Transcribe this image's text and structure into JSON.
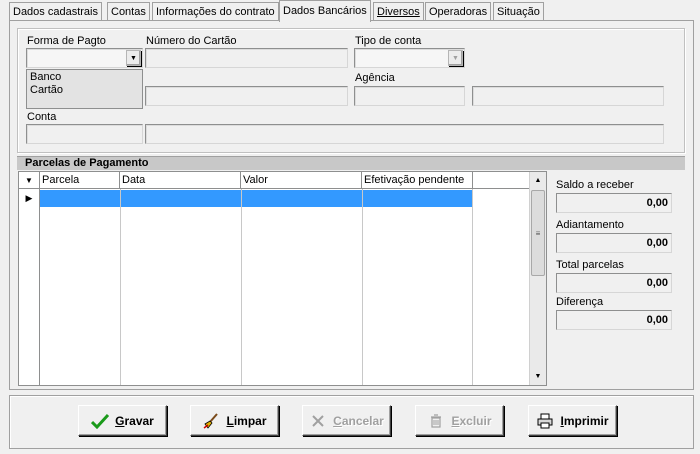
{
  "tabs": [
    {
      "label": "Dados cadastrais"
    },
    {
      "label": "Contas"
    },
    {
      "label": "Informações do contrato"
    },
    {
      "label": "Dados Bancários"
    },
    {
      "label": "Diversos"
    },
    {
      "label": "Operadoras"
    },
    {
      "label": "Situação"
    }
  ],
  "active_tab": "Dados Bancários",
  "form": {
    "forma_pagto_label": "Forma de Pagto",
    "forma_pagto_value": "",
    "forma_pagto_options": [
      "Banco",
      "Cartão"
    ],
    "numero_cartao_label": "Número do Cartão",
    "tipo_conta_label": "Tipo de conta",
    "agencia_label": "Agência",
    "conta_label": "Conta"
  },
  "parcelas": {
    "title": "Parcelas de Pagamento",
    "columns": [
      "Parcela",
      "Data",
      "Valor",
      "Efetivação pendente"
    ],
    "rows": []
  },
  "summary": {
    "saldo_label": "Saldo a receber",
    "saldo_value": "0,00",
    "adiantamento_label": "Adiantamento",
    "adiantamento_value": "0,00",
    "total_label": "Total parcelas",
    "total_value": "0,00",
    "diferenca_label": "Diferença",
    "diferenca_value": "0,00"
  },
  "buttons": {
    "gravar_first": "G",
    "gravar_rest": "ravar",
    "limpar_first": "L",
    "limpar_rest": "impar",
    "cancelar_first": "C",
    "cancelar_rest": "ancelar",
    "excluir_first": "E",
    "excluir_rest": "xcluir",
    "imprimir_first": "I",
    "imprimir_rest": "mprimir"
  },
  "colors": {
    "selection": "#3399ff",
    "section_header": "#c8c8c8",
    "check_green": "#1a9a1a"
  }
}
